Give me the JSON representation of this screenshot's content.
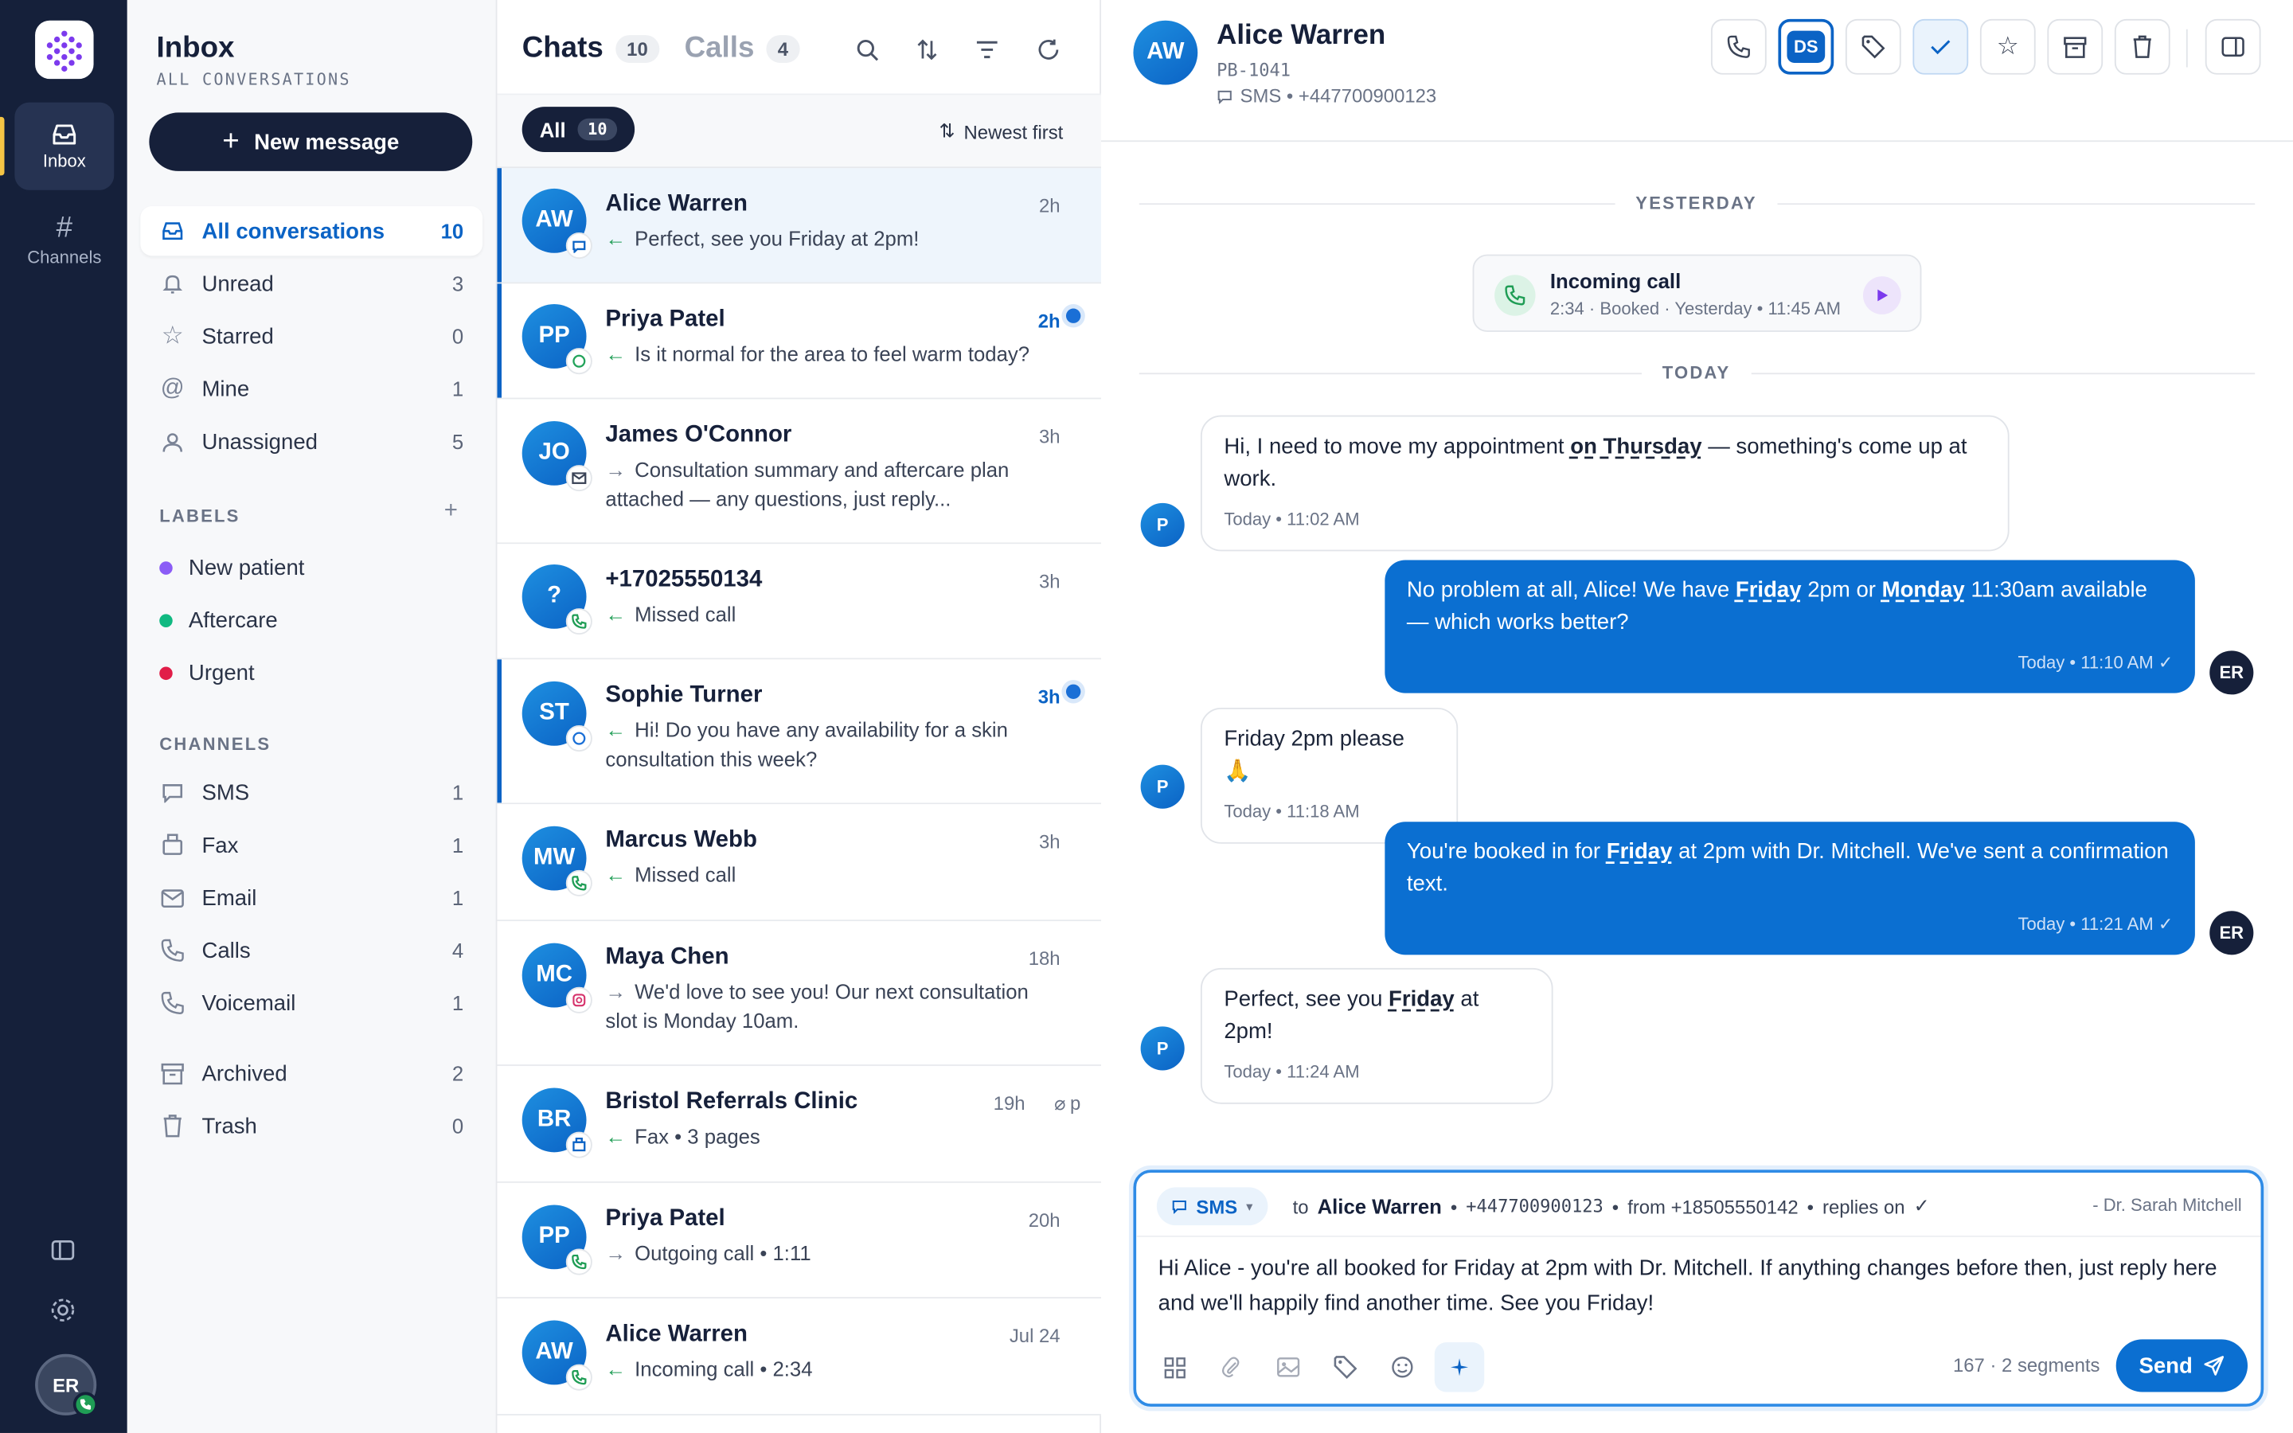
{
  "rail": {
    "inbox_label": "Inbox",
    "channels_label": "Channels",
    "user_initials": "ER"
  },
  "sidebar": {
    "title": "Inbox",
    "subtitle": "ALL CONVERSATIONS",
    "new_message": "New message",
    "views": [
      {
        "label": "All conversations",
        "count": "10"
      },
      {
        "label": "Unread",
        "count": "3"
      },
      {
        "label": "Starred",
        "count": "0"
      },
      {
        "label": "Mine",
        "count": "1"
      },
      {
        "label": "Unassigned",
        "count": "5"
      }
    ],
    "labels_heading": "LABELS",
    "labels": [
      {
        "label": "New patient",
        "color": "#8b5cf6"
      },
      {
        "label": "Aftercare",
        "color": "#10b981"
      },
      {
        "label": "Urgent",
        "color": "#e11d48"
      }
    ],
    "channels_heading": "CHANNELS",
    "channels": [
      {
        "label": "SMS",
        "count": "1"
      },
      {
        "label": "Fax",
        "count": "1"
      },
      {
        "label": "Email",
        "count": "1"
      },
      {
        "label": "Calls",
        "count": "4"
      },
      {
        "label": "Voicemail",
        "count": "1"
      }
    ],
    "archived": {
      "label": "Archived",
      "count": "2"
    },
    "trash": {
      "label": "Trash",
      "count": "0"
    }
  },
  "list": {
    "tab_chats": "Chats",
    "chats_count": "10",
    "tab_calls": "Calls",
    "calls_count": "4",
    "filter_all": "All",
    "filter_count": "10",
    "sort_label": "Newest first",
    "rows": [
      {
        "initials": "AW",
        "name": "Alice Warren",
        "time": "2h",
        "preview": "Perfect, see you Friday at 2pm!"
      },
      {
        "initials": "PP",
        "name": "Priya Patel",
        "time": "2h",
        "preview": "Is it normal for the area to feel warm today?"
      },
      {
        "initials": "JO",
        "name": "James O'Connor",
        "time": "3h",
        "preview": "Consultation summary and aftercare plan attached — any questions, just reply..."
      },
      {
        "initials": "?",
        "name": "+17025550134",
        "time": "3h",
        "preview": "Missed call"
      },
      {
        "initials": "ST",
        "name": "Sophie Turner",
        "time": "3h",
        "preview": "Hi! Do you have any availability for a skin consultation this week?"
      },
      {
        "initials": "MW",
        "name": "Marcus Webb",
        "time": "3h",
        "preview": "Missed call"
      },
      {
        "initials": "MC",
        "name": "Maya Chen",
        "time": "18h",
        "preview": "We'd love to see you! Our next consultation slot is Monday 10am."
      },
      {
        "initials": "BR",
        "name": "Bristol Referrals Clinic",
        "time": "19h",
        "preview": "Fax • 3 pages",
        "extra": "p"
      },
      {
        "initials": "PP",
        "name": "Priya Patel",
        "time": "20h",
        "preview": "Outgoing call • 1:11"
      },
      {
        "initials": "AW",
        "name": "Alice Warren",
        "time": "Jul 24",
        "preview": "Incoming call • 2:34"
      }
    ]
  },
  "main": {
    "initials": "AW",
    "name": "Alice Warren",
    "patient_id": "PB-1041",
    "channel": "SMS • +447700900123",
    "assignee_initials": "DS",
    "sep_yesterday": "YESTERDAY",
    "sep_today": "TODAY",
    "call": {
      "title": "Incoming call",
      "meta": "2:34 · Booked · Yesterday • 11:45 AM"
    },
    "m1": {
      "a": "Hi, I need to move my appointment ",
      "b": "on Thursday",
      "c": " — something's come up at work.",
      "ts": "Today • 11:02 AM"
    },
    "m2": {
      "a": "No problem at all, Alice! We have ",
      "b": "Friday",
      "c": " 2pm or ",
      "d": "Monday",
      "e": " 11:30am available — which works better?",
      "ts": "Today • 11:10 AM"
    },
    "m3": {
      "text": "Friday 2pm please 🙏",
      "ts": "Today • 11:18 AM"
    },
    "m4": {
      "a": "You're booked in for ",
      "b": "Friday",
      "c": " at 2pm with Dr. Mitchell. We've sent a confirmation text.",
      "ts": "Today • 11:21 AM"
    },
    "m5": {
      "a": "Perfect, see you ",
      "b": "Friday",
      "c": " at 2pm!",
      "ts": "Today • 11:24 AM"
    },
    "patient_initial": "P",
    "staff_initials": "ER"
  },
  "composer": {
    "channel": "SMS",
    "to_label": "to",
    "to_name": "Alice Warren",
    "to_number": "+447700900123",
    "from_text": "from +18505550142",
    "replies": "replies on",
    "signature": "- Dr. Sarah Mitchell",
    "text": "Hi Alice - you're all booked for Friday at 2pm with Dr. Mitchell. If anything changes before then, just reply here and we'll happily find another time. See you Friday!",
    "counter": "167 · 2 segments",
    "send": "Send"
  }
}
